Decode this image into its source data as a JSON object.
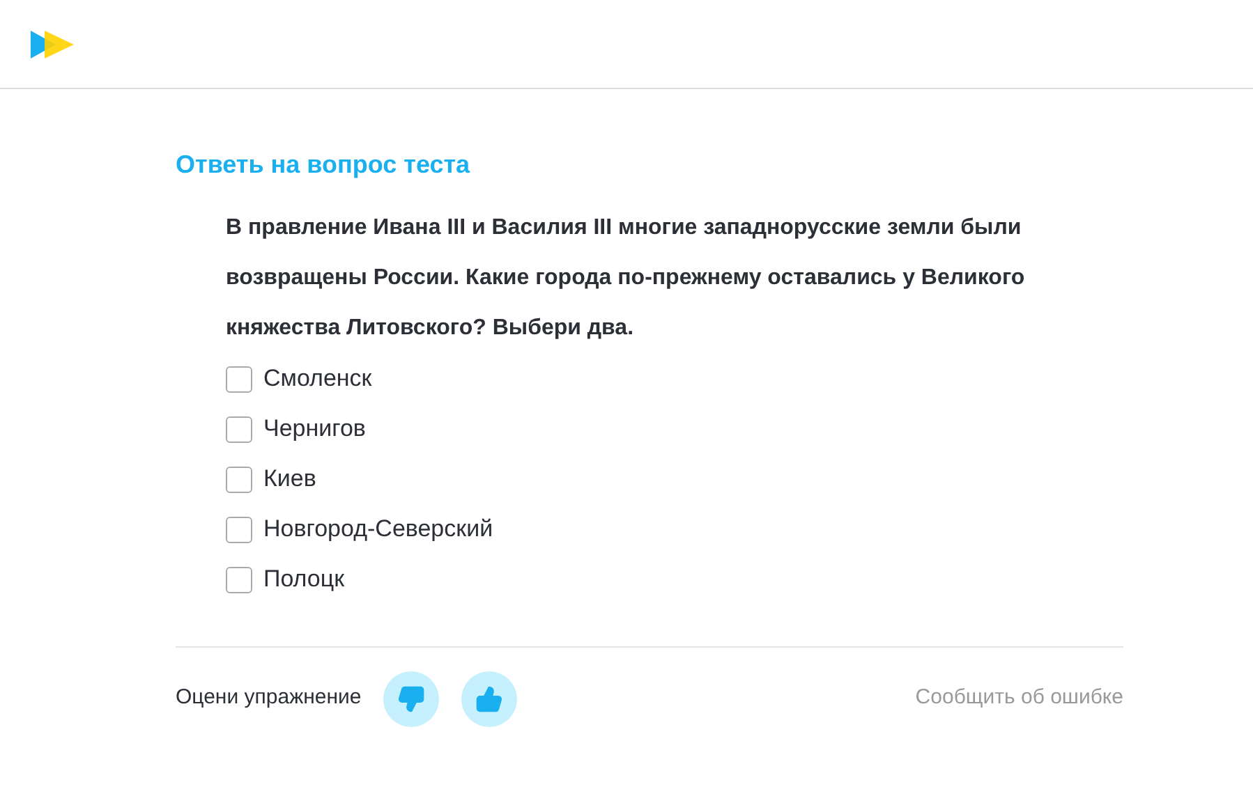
{
  "title": "Ответь на вопрос теста",
  "question": "В правление Ивана III и Василия III многие западнорусские земли были возвращены России. Какие города по-прежнему оставались у Великого княжества Литовского? Выбери два.",
  "options": [
    {
      "label": "Смоленск",
      "checked": false
    },
    {
      "label": "Чернигов",
      "checked": false
    },
    {
      "label": "Киев",
      "checked": false
    },
    {
      "label": "Новгород-Северский",
      "checked": false
    },
    {
      "label": "Полоцк",
      "checked": false
    }
  ],
  "footer": {
    "rate_label": "Оцени упражнение",
    "report_link": "Сообщить об ошибке"
  }
}
